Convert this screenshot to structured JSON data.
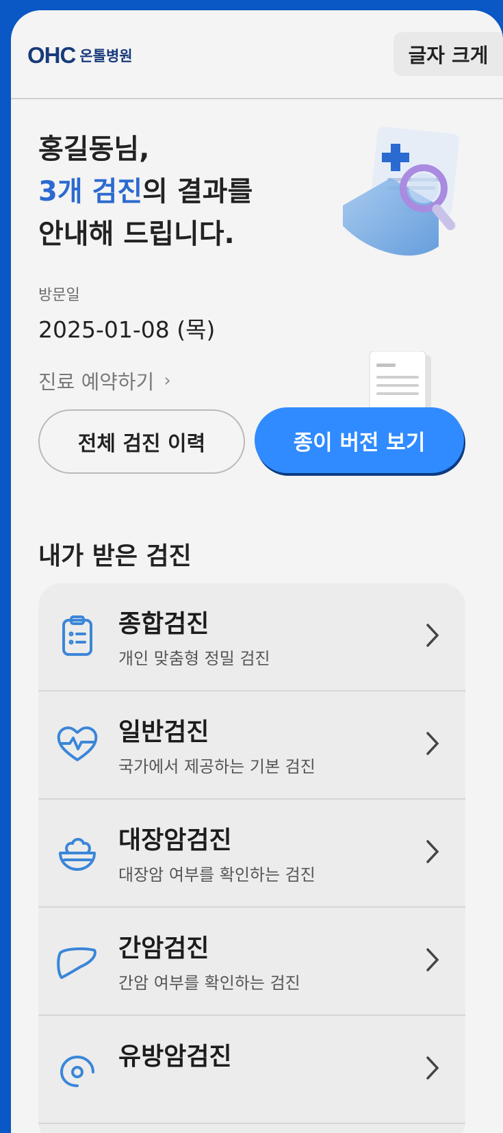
{
  "header": {
    "logo_mark": "OHC",
    "logo_text": "온톨병원",
    "font_size_button": "글자 크게"
  },
  "greeting": {
    "line1": "홍길동님,",
    "highlight": "3개 검진",
    "line2_rest": "의 결과를",
    "line3": "안내해 드립니다."
  },
  "visit": {
    "label": "방문일",
    "date": "2025-01-08  (목)"
  },
  "reserve": {
    "label": "진료 예약하기",
    "chevron": "›"
  },
  "buttons": {
    "history": "전체 검진 이력",
    "paper": "종이 버전 보기"
  },
  "section": {
    "title": "내가 받은 검진"
  },
  "exams": [
    {
      "title": "종합검진",
      "subtitle": "개인 맞춤형 정밀 검진",
      "icon": "clipboard-icon"
    },
    {
      "title": "일반검진",
      "subtitle": "국가에서 제공하는 기본 검진",
      "icon": "heart-pulse-icon"
    },
    {
      "title": "대장암검진",
      "subtitle": "대장암 여부를 확인하는 검진",
      "icon": "bowl-icon"
    },
    {
      "title": "간암검진",
      "subtitle": "간암 여부를 확인하는 검진",
      "icon": "liver-icon"
    },
    {
      "title": "유방암검진",
      "subtitle": "",
      "icon": "breast-icon"
    }
  ],
  "colors": {
    "accent": "#2f8bff",
    "highlight_text": "#2b6ad0",
    "frame": "#0a57c6",
    "icon_blue": "#3a86d8"
  }
}
